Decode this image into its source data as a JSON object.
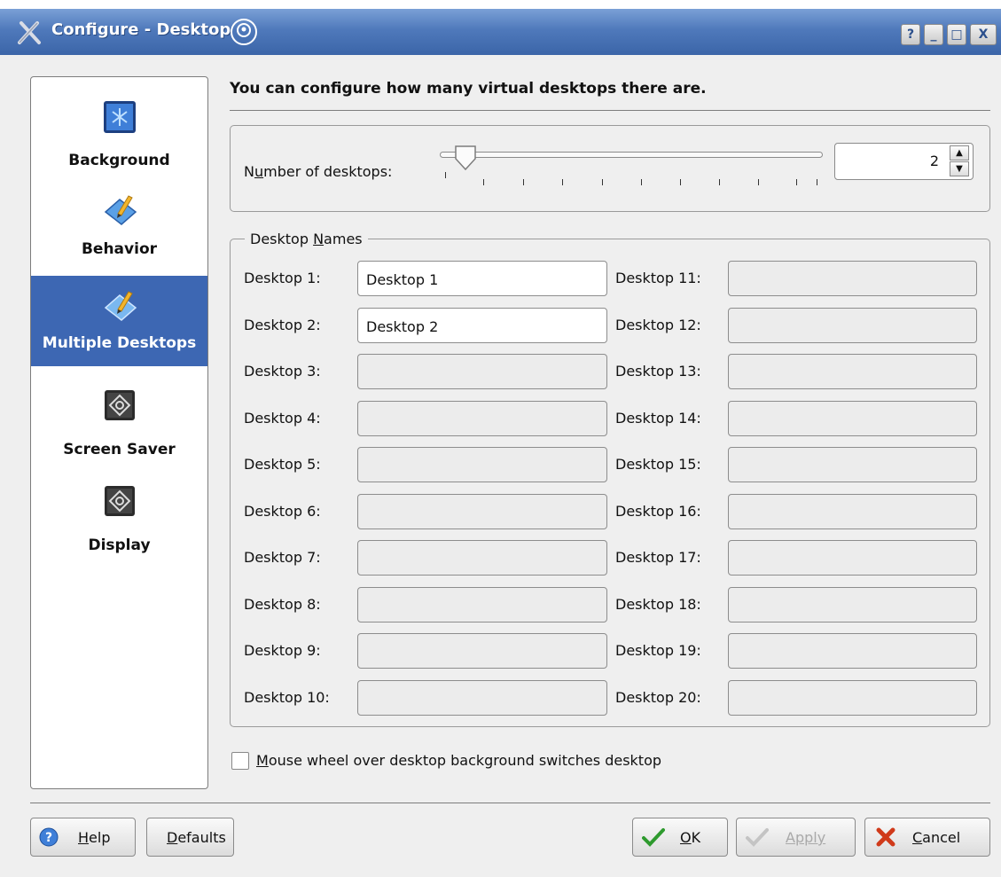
{
  "window": {
    "title": "Configure - Desktop",
    "buttons": {
      "help": "?",
      "minimize": "_",
      "maximize": "□",
      "close": "X"
    }
  },
  "sidebar": {
    "items": [
      {
        "label": "Background",
        "icon": "background-icon",
        "selected": false
      },
      {
        "label": "Behavior",
        "icon": "behavior-icon",
        "selected": false
      },
      {
        "label": "Multiple Desktops",
        "icon": "multiple-desktops-icon",
        "selected": true
      },
      {
        "label": "Screen Saver",
        "icon": "screen-saver-icon",
        "selected": false
      },
      {
        "label": "Display",
        "icon": "display-icon",
        "selected": false
      }
    ]
  },
  "main": {
    "heading": "You can configure how many virtual desktops there are.",
    "number_of_desktops": {
      "label_pre": "N",
      "label_mnemonic": "u",
      "label_post": "mber of desktops:",
      "value": "2",
      "slider_value": 2
    },
    "desktop_names": {
      "legend_pre": "Desktop ",
      "legend_mnemonic": "N",
      "legend_post": "ames",
      "rows": [
        {
          "label": "Desktop 1:",
          "value": "Desktop 1",
          "enabled": true
        },
        {
          "label": "Desktop 2:",
          "value": "Desktop 2",
          "enabled": true
        },
        {
          "label": "Desktop 3:",
          "value": "",
          "enabled": false
        },
        {
          "label": "Desktop 4:",
          "value": "",
          "enabled": false
        },
        {
          "label": "Desktop 5:",
          "value": "",
          "enabled": false
        },
        {
          "label": "Desktop 6:",
          "value": "",
          "enabled": false
        },
        {
          "label": "Desktop 7:",
          "value": "",
          "enabled": false
        },
        {
          "label": "Desktop 8:",
          "value": "",
          "enabled": false
        },
        {
          "label": "Desktop 9:",
          "value": "",
          "enabled": false
        },
        {
          "label": "Desktop 10:",
          "value": "",
          "enabled": false
        },
        {
          "label": "Desktop 11:",
          "value": "",
          "enabled": false
        },
        {
          "label": "Desktop 12:",
          "value": "",
          "enabled": false
        },
        {
          "label": "Desktop 13:",
          "value": "",
          "enabled": false
        },
        {
          "label": "Desktop 14:",
          "value": "",
          "enabled": false
        },
        {
          "label": "Desktop 15:",
          "value": "",
          "enabled": false
        },
        {
          "label": "Desktop 16:",
          "value": "",
          "enabled": false
        },
        {
          "label": "Desktop 17:",
          "value": "",
          "enabled": false
        },
        {
          "label": "Desktop 18:",
          "value": "",
          "enabled": false
        },
        {
          "label": "Desktop 19:",
          "value": "",
          "enabled": false
        },
        {
          "label": "Desktop 20:",
          "value": "",
          "enabled": false
        }
      ]
    },
    "mouse_wheel": {
      "mnemonic": "M",
      "label_post": "ouse wheel over desktop background switches desktop",
      "checked": false
    }
  },
  "footer": {
    "help": {
      "mnemonic": "H",
      "post": "elp",
      "icon": "help-icon"
    },
    "defaults": {
      "mnemonic": "D",
      "post": "efaults"
    },
    "ok": {
      "mnemonic": "O",
      "post": "K",
      "icon": "checkmark-icon"
    },
    "apply": {
      "mnemonic": "",
      "post": "Apply",
      "icon": "checkmark-icon",
      "enabled": false
    },
    "cancel": {
      "mnemonic": "C",
      "post": "ancel",
      "icon": "cancel-icon"
    }
  },
  "colors": {
    "titlebar": "#4f79bb",
    "selection": "#3d67b3",
    "ok_check": "#2e9a2e",
    "cancel_x": "#d03a1a"
  }
}
